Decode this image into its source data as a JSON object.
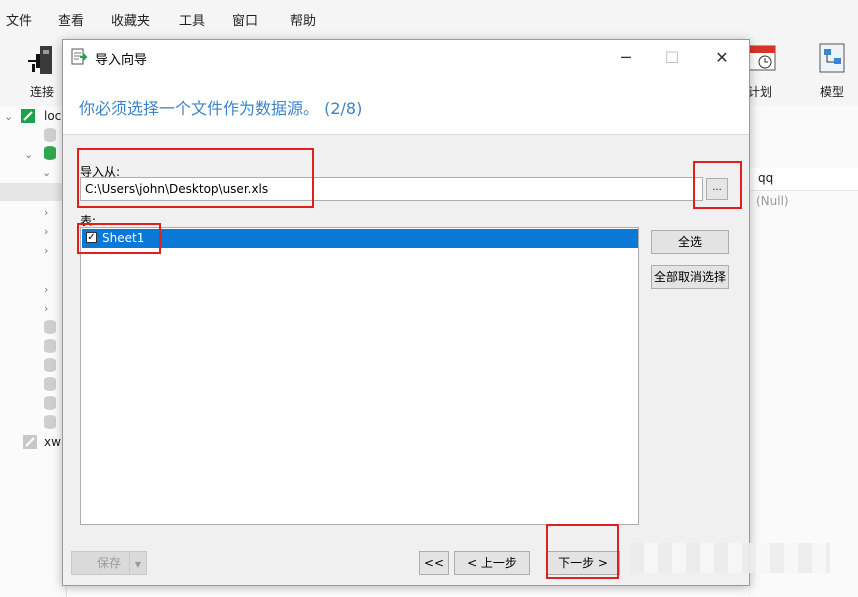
{
  "menubar": {
    "items": [
      "文件",
      "查看",
      "收藏夹",
      "工具",
      "窗口",
      "帮助"
    ]
  },
  "toolbar": {
    "left_label": "连接",
    "right_items": [
      {
        "label": "计划",
        "icon": "calendar-icon"
      },
      {
        "label": "模型",
        "icon": "model-icon"
      }
    ]
  },
  "sidebar": {
    "tree_items": [
      "loc",
      "xw"
    ]
  },
  "grid": {
    "column_header": "qq",
    "cell_value": "(Null)"
  },
  "dialog": {
    "title": "导入向导",
    "heading": "你必须选择一个文件作为数据源。 (2/8)",
    "import_from_label": "导入从:",
    "file_path": "C:\\Users\\john\\Desktop\\user.xls",
    "browse_label": "...",
    "table_label": "表:",
    "tables": [
      {
        "name": "Sheet1",
        "checked": true,
        "selected": true
      }
    ],
    "select_all_label": "全选",
    "deselect_all_label": "全部取消选择",
    "save_label": "保存",
    "first_label": "<<",
    "prev_label": "< 上一步",
    "next_label": "下一步 >"
  },
  "colors": {
    "accent_blue": "#3a84c9",
    "selection_blue": "#0a78d7",
    "annotation_red": "#e0201a"
  }
}
